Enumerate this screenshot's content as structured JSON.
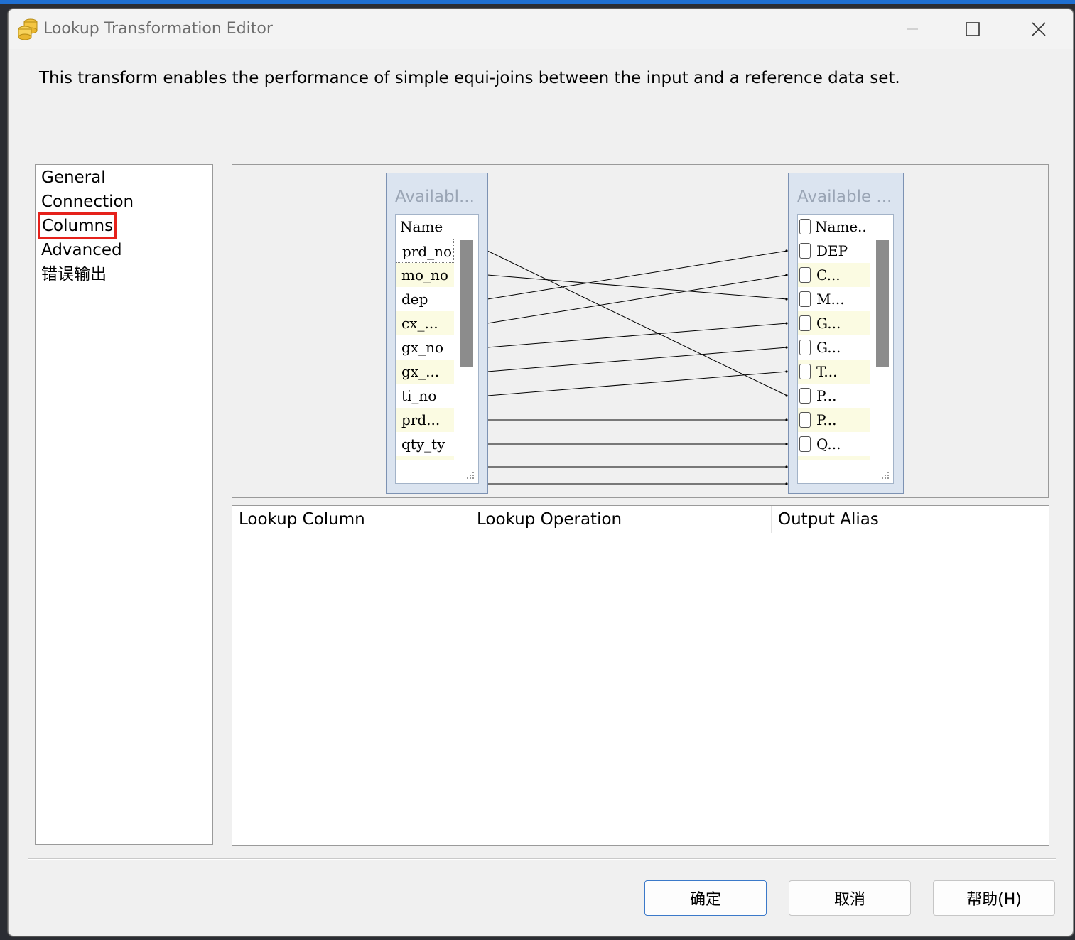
{
  "window": {
    "title": "Lookup Transformation Editor",
    "minimize_icon": "minimize-icon",
    "maximize_icon": "maximize-icon",
    "close_icon": "close-icon",
    "app_icon": "database-cylinders-icon"
  },
  "description": "This transform enables the performance of simple equi-joins between the input and a reference data set.",
  "nav": {
    "items": [
      {
        "label": "General"
      },
      {
        "label": "Connection"
      },
      {
        "label": "Columns"
      },
      {
        "label": "Advanced"
      },
      {
        "label": "错误输出"
      }
    ],
    "selected": "Columns",
    "highlight_color": "#e5211b"
  },
  "mapping": {
    "input_box": {
      "title": "Availabl...",
      "header": "Name",
      "columns": [
        "prd_no",
        "mo_no",
        "dep",
        "cx_...",
        "gx_no",
        "gx_...",
        "ti_no",
        "prd...",
        "qty_ty"
      ]
    },
    "lookup_box": {
      "title": "Available ...",
      "header": "Name",
      "header_extra": "..",
      "columns": [
        "DEP",
        "C...",
        "M...",
        "G...",
        "G...",
        "T...",
        "P...",
        "P...",
        "Q..."
      ]
    },
    "links": [
      [
        0,
        6
      ],
      [
        1,
        2
      ],
      [
        2,
        0
      ],
      [
        3,
        1
      ],
      [
        4,
        3
      ],
      [
        5,
        4
      ],
      [
        6,
        5
      ],
      [
        7,
        7
      ],
      [
        8,
        8
      ],
      [
        9,
        9
      ],
      [
        10,
        10
      ]
    ]
  },
  "grid": {
    "columns": [
      "Lookup Column",
      "Lookup Operation",
      "Output Alias"
    ]
  },
  "buttons": {
    "ok": "确定",
    "cancel": "取消",
    "help": "帮助(H)"
  },
  "colors": {
    "alt_row": "#fbfbe2",
    "box_bg": "#dbe4f0",
    "default_button_border": "#3b79c9"
  }
}
